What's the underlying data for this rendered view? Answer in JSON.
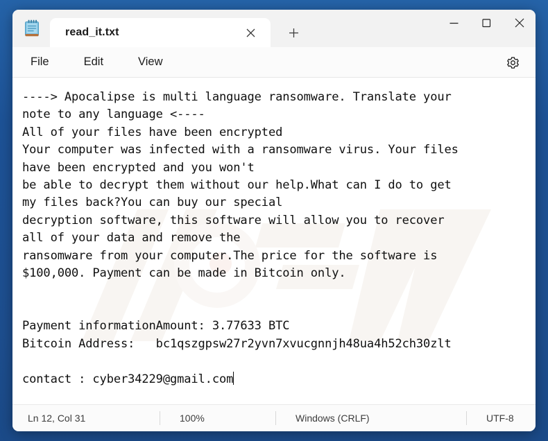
{
  "window": {
    "app_icon": "notepad-icon",
    "controls": {
      "minimize": "minimize-icon",
      "maximize": "maximize-icon",
      "close": "close-icon"
    }
  },
  "tabbar": {
    "active_tab": "read_it.txt",
    "close_tab_icon": "close-icon",
    "new_tab_icon": "plus-icon"
  },
  "menubar": {
    "items": [
      {
        "label": "File"
      },
      {
        "label": "Edit"
      },
      {
        "label": "View"
      }
    ],
    "settings_icon": "gear-icon"
  },
  "editor": {
    "filename": "read_it.txt",
    "content": "----> Apocalipse is multi language ransomware. Translate your\nnote to any language <----\nAll of your files have been encrypted\nYour computer was infected with a ransomware virus. Your files\nhave been encrypted and you won't\nbe able to decrypt them without our help.What can I do to get\nmy files back?You can buy our special\ndecryption software, this software will allow you to recover\nall of your data and remove the\nransomware from your computer.The price for the software is\n$100,000. Payment can be made in Bitcoin only.\n\n\nPayment informationAmount: 3.77633 BTC\nBitcoin Address:   bc1qszgpsw27r2yvn7xvucgnnjh48ua4h52ch30zlt\n\ncontact : cyber34229@gmail.com",
    "ransom_details": {
      "ransomware_name": "Apocalipse",
      "price_usd": "$100,000",
      "amount_btc": "3.77633 BTC",
      "bitcoin_address": "bc1qszgpsw27r2yvn7xvucgnnjh48ua4h52ch30zlt",
      "contact_email": "cyber34229@gmail.com"
    }
  },
  "statusbar": {
    "cursor_position": "Ln 12, Col 31",
    "zoom": "100%",
    "line_ending": "Windows (CRLF)",
    "encoding": "UTF-8"
  },
  "colors": {
    "desktop": "#1d5296",
    "titlebar": "#f2f2f2",
    "tab_active": "#ffffff",
    "editor_bg": "#ffffff",
    "text": "#101010"
  }
}
